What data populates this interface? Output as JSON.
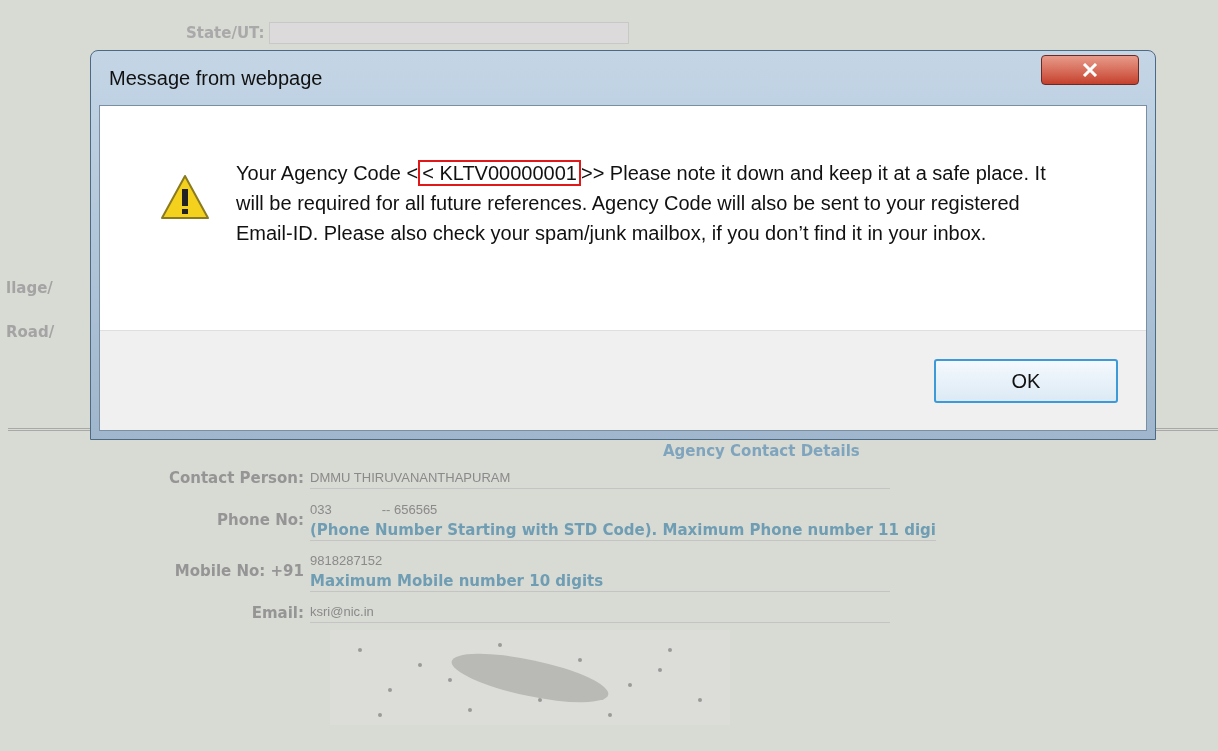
{
  "background_form": {
    "state_label": "State/UT:",
    "address_labels": [
      "llage/",
      "Road/"
    ],
    "section_title": "Agency Contact Details",
    "fields": [
      {
        "label": "Contact Person:",
        "values": [
          "DMMU THIRUVANANTHAPURAM"
        ]
      },
      {
        "label": "Phone No:",
        "values": [
          "033",
          "-- 656565"
        ],
        "hint": "(Phone Number Starting with STD Code). Maximum Phone number 11 digi"
      },
      {
        "label": "Mobile No: +91",
        "values": [
          "9818287152"
        ],
        "hint": "Maximum Mobile number 10 digits"
      },
      {
        "label": "Email:",
        "values": [
          "ksri@nic.in"
        ]
      }
    ]
  },
  "dialog": {
    "title": "Message from webpage",
    "message_before": "Your Agency Code <",
    "message_highlight": "< KLTV00000001",
    "message_after": ">> Please note it down and keep it at a safe place. It will be required for all future references. Agency Code will also be sent to your registered Email-ID. Please also check your spam/junk mailbox, if you don’t find it in your inbox.",
    "buttons": [
      "OK"
    ]
  }
}
